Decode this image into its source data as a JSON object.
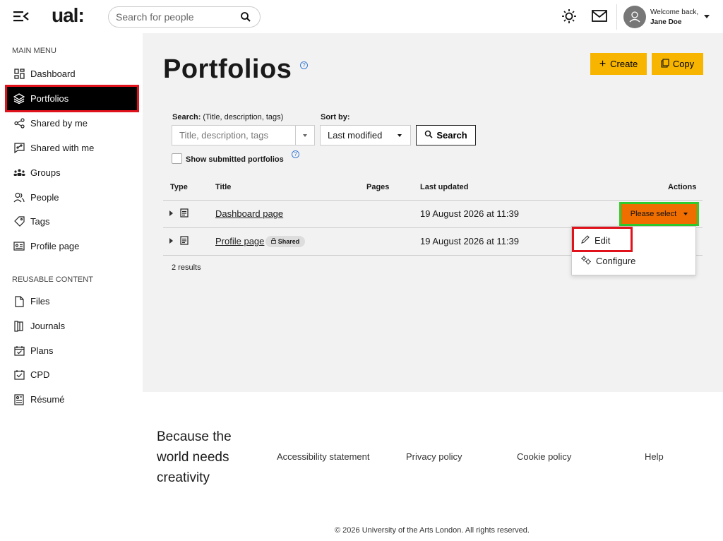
{
  "header": {
    "logo": "ual:",
    "search_placeholder": "Search for people",
    "welcome": "Welcome back,",
    "user_name": "Jane Doe"
  },
  "sidebar": {
    "main_heading": "MAIN MENU",
    "main_items": [
      {
        "label": "Dashboard",
        "icon": "dashboard-icon"
      },
      {
        "label": "Portfolios",
        "icon": "layers-icon",
        "active": true
      },
      {
        "label": "Shared by me",
        "icon": "share-icon"
      },
      {
        "label": "Shared with me",
        "icon": "shared-with-me-icon"
      },
      {
        "label": "Groups",
        "icon": "groups-icon"
      },
      {
        "label": "People",
        "icon": "people-icon"
      },
      {
        "label": "Tags",
        "icon": "tag-icon"
      },
      {
        "label": "Profile page",
        "icon": "profile-card-icon"
      }
    ],
    "reusable_heading": "REUSABLE CONTENT",
    "reusable_items": [
      {
        "label": "Files",
        "icon": "file-icon"
      },
      {
        "label": "Journals",
        "icon": "journal-icon"
      },
      {
        "label": "Plans",
        "icon": "plans-icon"
      },
      {
        "label": "CPD",
        "icon": "cpd-icon"
      },
      {
        "label": "Résumé",
        "icon": "resume-icon"
      }
    ]
  },
  "main": {
    "title": "Portfolios",
    "create_label": "Create",
    "copy_label": "Copy",
    "search_label": "Search:",
    "search_hint": "(Title, description, tags)",
    "search_placeholder": "Title, description, tags",
    "sort_label": "Sort by:",
    "sort_value": "Last modified",
    "search_button": "Search",
    "show_submitted": "Show submitted portfolios",
    "columns": {
      "type": "Type",
      "title": "Title",
      "pages": "Pages",
      "last_updated": "Last updated",
      "actions": "Actions"
    },
    "rows": [
      {
        "title": "Dashboard page",
        "date": "19 August 2026 at 11:39"
      },
      {
        "title": "Profile page",
        "badge": "Shared",
        "date": "19 August 2026 at 11:39"
      }
    ],
    "action_select": "Please select",
    "dropdown": {
      "edit": "Edit",
      "configure": "Configure"
    },
    "results": "2 results"
  },
  "footer": {
    "tagline": "Because the world needs creativity",
    "links": [
      "Accessibility statement",
      "Privacy policy",
      "Cookie policy",
      "Help"
    ],
    "copyright": "© 2026 University of the Arts London. All rights reserved."
  },
  "colors": {
    "accent": "#f7b500",
    "action": "#f06d00",
    "highlight_red": "#e0121c",
    "highlight_green": "#2ecc2e"
  }
}
